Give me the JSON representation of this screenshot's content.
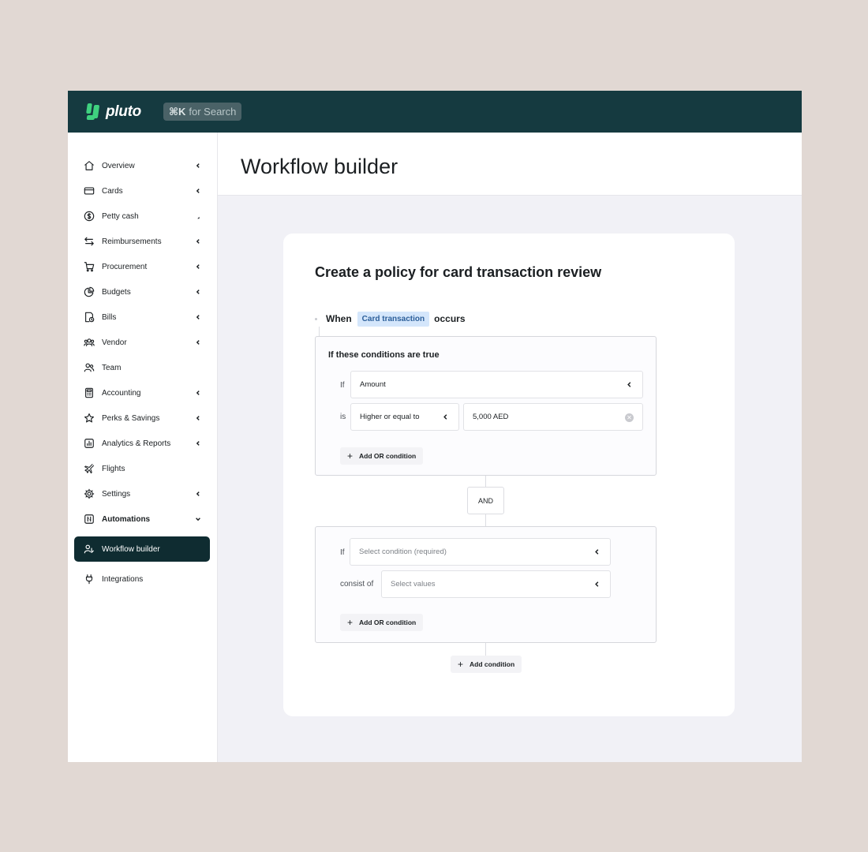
{
  "brand": {
    "name": "pluto",
    "search_key": "⌘K",
    "search_text": "for Search"
  },
  "sidebar": {
    "items": [
      {
        "label": "Overview",
        "icon": "home-icon",
        "chevron": "left"
      },
      {
        "label": "Cards",
        "icon": "card-icon",
        "chevron": "left"
      },
      {
        "label": "Petty cash",
        "icon": "dollar-circle-icon",
        "chevron": "corner"
      },
      {
        "label": "Reimbursements",
        "icon": "arrows-swap-icon",
        "chevron": "left"
      },
      {
        "label": "Procurement",
        "icon": "cart-icon",
        "chevron": "left"
      },
      {
        "label": "Budgets",
        "icon": "pie-chart-icon",
        "chevron": "left"
      },
      {
        "label": "Bills",
        "icon": "bill-icon",
        "chevron": "left"
      },
      {
        "label": "Vendor",
        "icon": "vendor-group-icon",
        "chevron": "left"
      },
      {
        "label": "Team",
        "icon": "team-icon",
        "chevron": "none"
      },
      {
        "label": "Accounting",
        "icon": "calculator-icon",
        "chevron": "left"
      },
      {
        "label": "Perks & Savings",
        "icon": "star-icon",
        "chevron": "left"
      },
      {
        "label": "Analytics & Reports",
        "icon": "analytics-icon",
        "chevron": "left"
      },
      {
        "label": "Flights",
        "icon": "plane-icon",
        "chevron": "none"
      },
      {
        "label": "Settings",
        "icon": "gear-icon",
        "chevron": "left"
      },
      {
        "label": "Automations",
        "icon": "automation-icon",
        "chevron": "down"
      }
    ],
    "active_item": {
      "label": "Workflow builder",
      "icon": "workflow-users-icon"
    },
    "after_item": {
      "label": "Integrations",
      "icon": "plug-icon"
    }
  },
  "header": {
    "title": "Workflow builder"
  },
  "policy": {
    "title": "Create a policy for card transaction review",
    "when_label": "When",
    "trigger": "Card transaction",
    "occurs_label": "occurs",
    "group1": {
      "title": "If these conditions are true",
      "if_label": "If",
      "field_value": "Amount",
      "is_label": "is",
      "operator_value": "Higher or equal to",
      "amount_value": "5,000 AED",
      "add_or_label": "Add OR condition"
    },
    "and_label": "AND",
    "group2": {
      "if_label": "If",
      "condition_placeholder": "Select condition (required)",
      "consist_label": "consist of",
      "values_placeholder": "Select values",
      "add_or_label": "Add OR condition"
    },
    "add_condition_label": "Add condition"
  },
  "colors": {
    "topbar": "#153a40",
    "brand_green": "#3fd17f",
    "active_nav": "#0f2c31",
    "chip_bg": "#d4e6fb",
    "chip_text": "#2c5f9a"
  }
}
